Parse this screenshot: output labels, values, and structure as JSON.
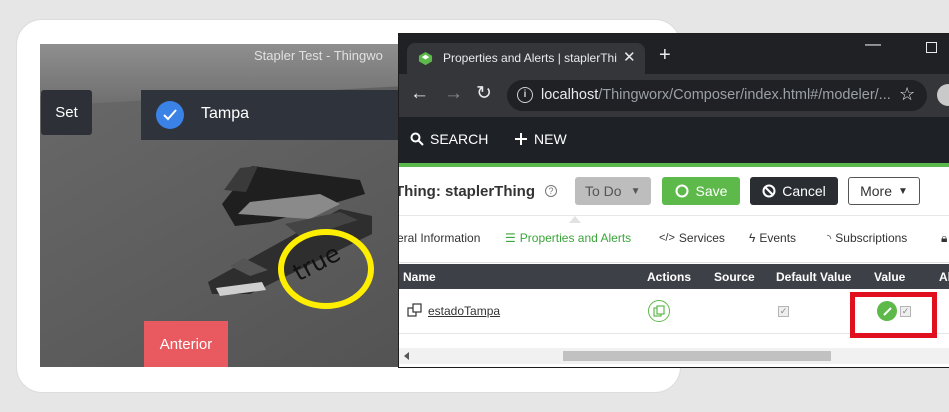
{
  "scene": {
    "title": "Stapler Test - Thingwo",
    "set_label": "Set",
    "tampa_label": "Tampa",
    "anterior_label": "Anterior",
    "ar_text": "true"
  },
  "browser": {
    "tab_title": "Properties and Alerts | staplerThi",
    "tab_close": "✕",
    "new_tab": "+",
    "url_host": "localhost",
    "url_path": "/Thingworx/Composer/index.html#/modeler/..."
  },
  "composer": {
    "search_label": "SEARCH",
    "new_label": "NEW",
    "thing_title": "Thing: staplerThing",
    "todo_label": "To Do",
    "save_label": "Save",
    "cancel_label": "Cancel",
    "more_label": "More",
    "tabs": [
      "eral Information",
      "Properties and Alerts",
      "Services",
      "Events",
      "Subscriptions"
    ],
    "columns": {
      "name": "Name",
      "actions": "Actions",
      "source": "Source",
      "default_value": "Default Value",
      "value": "Value",
      "extra": "Al"
    },
    "row": {
      "name": "estadoTampa",
      "default_checked": true,
      "value_checked": true
    }
  },
  "colors": {
    "accent_green": "#5db94a",
    "highlight_red": "#e0101e",
    "ar_circle": "#ffee00",
    "anterior_red": "#e85a5f",
    "check_blue": "#3b82e6"
  }
}
